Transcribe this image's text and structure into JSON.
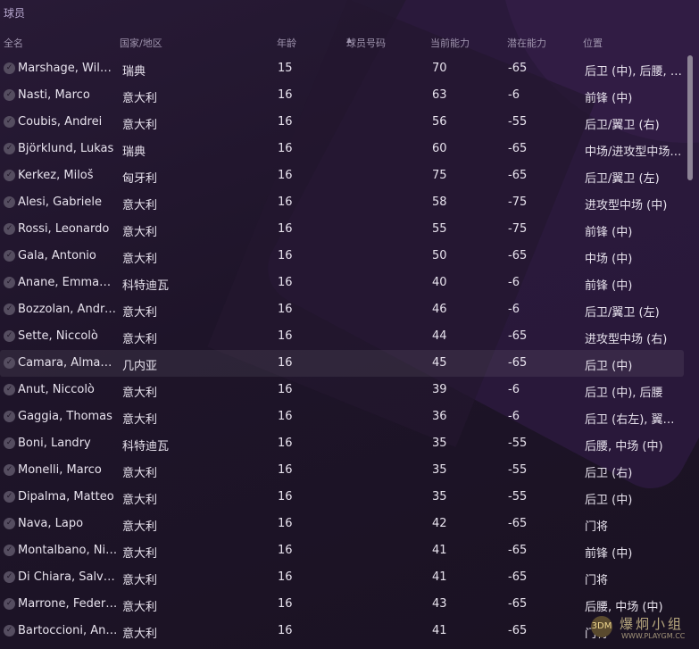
{
  "panel": {
    "title": "球员"
  },
  "columns": {
    "name": "全名",
    "nation": "国家/地区",
    "age": "年龄",
    "number": "球员号码",
    "current_ability": "当前能力",
    "potential_ability": "潜在能力",
    "position": "位置"
  },
  "sort": {
    "column": "number",
    "direction": "ascending",
    "icon": "sort-ascending-icon"
  },
  "players": [
    {
      "name": "Marshage, Wilgot",
      "nation": "瑞典",
      "age": "15",
      "number": "",
      "ca": "70",
      "pa": "-65",
      "position": "后卫 (中), 后腰, 中场 (中)"
    },
    {
      "name": "Nasti, Marco",
      "nation": "意大利",
      "age": "16",
      "number": "",
      "ca": "63",
      "pa": "-6",
      "position": "前锋 (中)"
    },
    {
      "name": "Coubis, Andrei",
      "nation": "意大利",
      "age": "16",
      "number": "",
      "ca": "56",
      "pa": "-55",
      "position": "后卫/翼卫 (右)"
    },
    {
      "name": "Björklund, Lukas",
      "nation": "瑞典",
      "age": "16",
      "number": "",
      "ca": "60",
      "pa": "-65",
      "position": "中场/进攻型中场 (中)"
    },
    {
      "name": "Kerkez, Miloš",
      "nation": "匈牙利",
      "age": "16",
      "number": "",
      "ca": "75",
      "pa": "-65",
      "position": "后卫/翼卫 (左)"
    },
    {
      "name": "Alesi, Gabriele",
      "nation": "意大利",
      "age": "16",
      "number": "",
      "ca": "58",
      "pa": "-75",
      "position": "进攻型中场 (中)"
    },
    {
      "name": "Rossi, Leonardo",
      "nation": "意大利",
      "age": "16",
      "number": "",
      "ca": "55",
      "pa": "-75",
      "position": "前锋 (中)"
    },
    {
      "name": "Gala, Antonio",
      "nation": "意大利",
      "age": "16",
      "number": "",
      "ca": "50",
      "pa": "-65",
      "position": "中场 (中)"
    },
    {
      "name": "Anane, Emmanuel",
      "nation": "科特迪瓦",
      "age": "16",
      "number": "",
      "ca": "40",
      "pa": "-6",
      "position": "前锋 (中)"
    },
    {
      "name": "Bozzolan, Andrea",
      "nation": "意大利",
      "age": "16",
      "number": "",
      "ca": "46",
      "pa": "-6",
      "position": "后卫/翼卫 (左)"
    },
    {
      "name": "Sette, Niccolò",
      "nation": "意大利",
      "age": "16",
      "number": "",
      "ca": "44",
      "pa": "-65",
      "position": "进攻型中场 (右)"
    },
    {
      "name": "Camara, Almamy",
      "nation": "几内亚",
      "age": "16",
      "number": "",
      "ca": "45",
      "pa": "-65",
      "position": "后卫 (中)"
    },
    {
      "name": "Anut, Niccolò",
      "nation": "意大利",
      "age": "16",
      "number": "",
      "ca": "39",
      "pa": "-6",
      "position": "后卫 (中), 后腰"
    },
    {
      "name": "Gaggia, Thomas",
      "nation": "意大利",
      "age": "16",
      "number": "",
      "ca": "36",
      "pa": "-6",
      "position": "后卫 (右左), 翼卫 (右)"
    },
    {
      "name": "Boni, Landry",
      "nation": "科特迪瓦",
      "age": "16",
      "number": "",
      "ca": "35",
      "pa": "-55",
      "position": "后腰, 中场 (中)"
    },
    {
      "name": "Monelli, Marco",
      "nation": "意大利",
      "age": "16",
      "number": "",
      "ca": "35",
      "pa": "-55",
      "position": "后卫 (右)"
    },
    {
      "name": "Dipalma, Matteo",
      "nation": "意大利",
      "age": "16",
      "number": "",
      "ca": "35",
      "pa": "-55",
      "position": "后卫 (中)"
    },
    {
      "name": "Nava, Lapo",
      "nation": "意大利",
      "age": "16",
      "number": "",
      "ca": "42",
      "pa": "-65",
      "position": "门将"
    },
    {
      "name": "Montalbano, Nicolò",
      "nation": "意大利",
      "age": "16",
      "number": "",
      "ca": "41",
      "pa": "-65",
      "position": "前锋 (中)"
    },
    {
      "name": "Di Chiara, Salvatore",
      "nation": "意大利",
      "age": "16",
      "number": "",
      "ca": "41",
      "pa": "-65",
      "position": "门将"
    },
    {
      "name": "Marrone, Federico",
      "nation": "意大利",
      "age": "16",
      "number": "",
      "ca": "43",
      "pa": "-65",
      "position": "后腰, 中场 (中)"
    },
    {
      "name": "Bartoccioni, Andrea",
      "nation": "意大利",
      "age": "16",
      "number": "",
      "ca": "41",
      "pa": "-65",
      "position": "门将"
    }
  ],
  "selected_index": 11,
  "watermark": {
    "text": "爆炯小组",
    "url": "WWW.PLAYGM.CC",
    "logo": "3DM"
  },
  "colors": {
    "background": "#1d1426",
    "title": "#b7a8cf",
    "header": "#9e93ad",
    "text": "#e8e3ee"
  }
}
